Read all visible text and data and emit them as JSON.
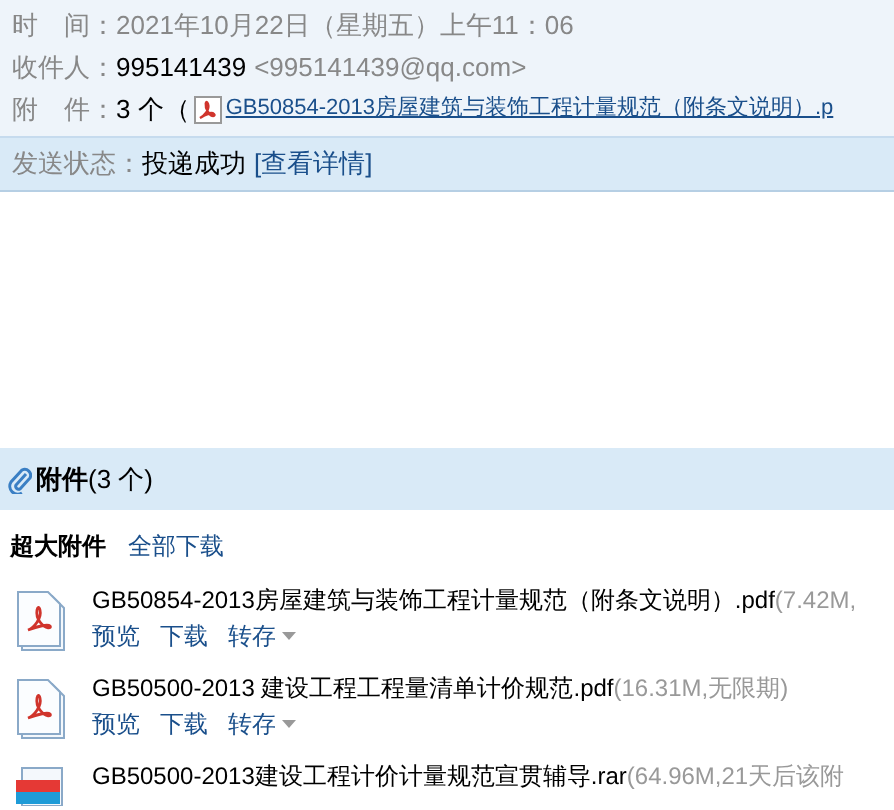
{
  "header": {
    "time_label": "时　间：",
    "time": "2021年10月22日（星期五）上午11：06",
    "recipient_label": "收件人：",
    "recipient_name": "995141439",
    "recipient_email": "<995141439@qq.com>",
    "attachments_label": "附　件：",
    "attachments_count": "3 个（",
    "attachment_link": "GB50854-2013房屋建筑与装饰工程计量规范（附条文说明）.p"
  },
  "status": {
    "label": "发送状态：",
    "value": "投递成功",
    "details": "[查看详情]"
  },
  "attachments": {
    "title": "附件",
    "count": "(3 个)",
    "section": "超大附件",
    "download_all": "全部下载",
    "items": [
      {
        "kind": "pdf",
        "name": "GB50854-2013房屋建筑与装饰工程计量规范（附条文说明）.pdf",
        "meta": "(7.42M,",
        "actions": [
          "预览",
          "下载",
          "转存"
        ]
      },
      {
        "kind": "pdf",
        "name": "GB50500-2013 建设工程工程量清单计价规范.pdf",
        "meta": "(16.31M,无限期)",
        "actions": [
          "预览",
          "下载",
          "转存"
        ]
      },
      {
        "kind": "rar",
        "name": "GB50500-2013建设工程计价计量规范宣贯辅导.rar",
        "meta": "(64.96M,21天后该附"
      }
    ]
  }
}
